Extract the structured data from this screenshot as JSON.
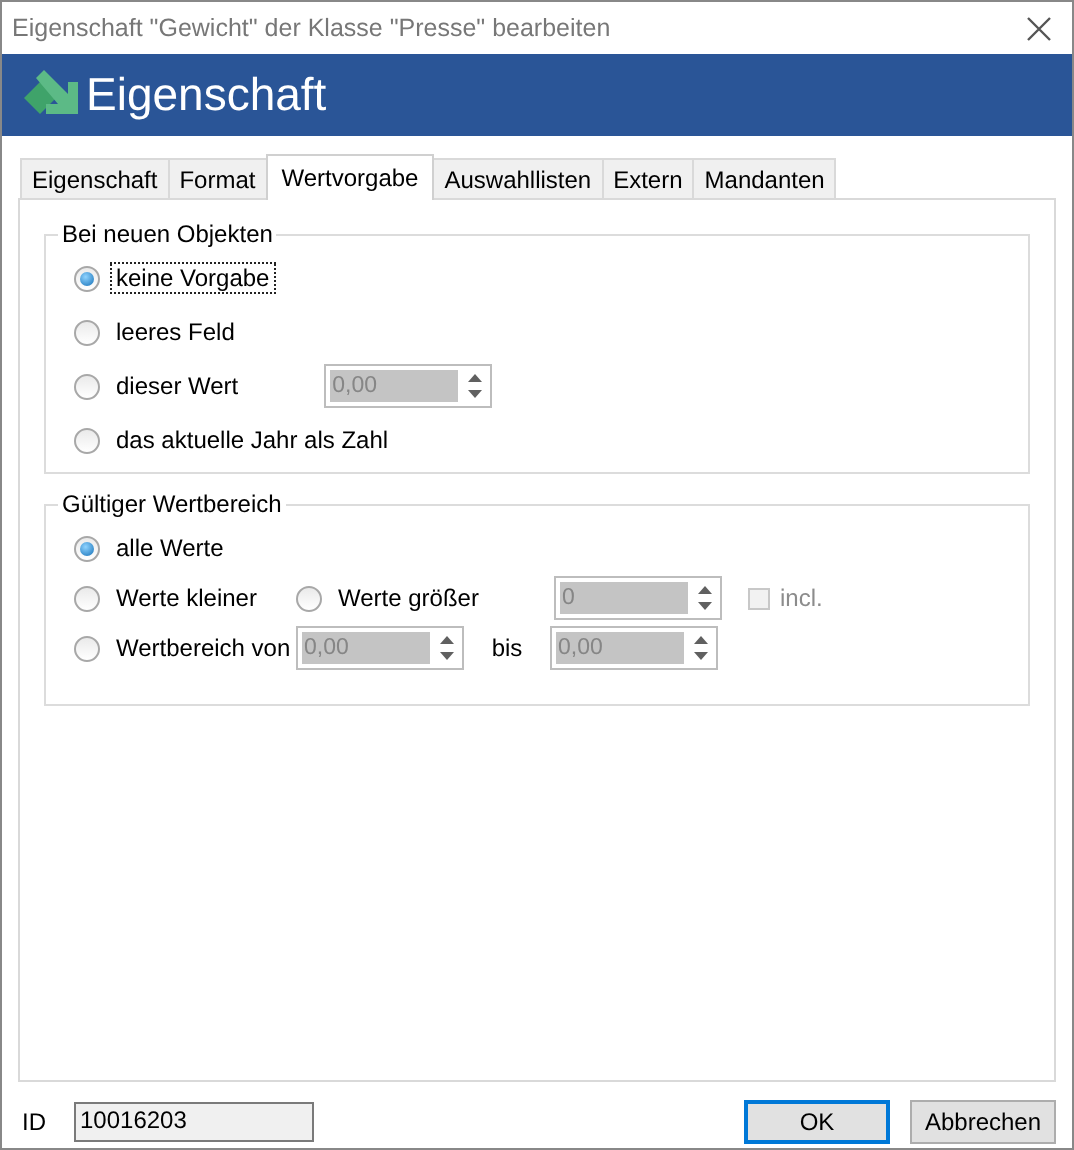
{
  "window": {
    "title": "Eigenschaft \"Gewicht\" der Klasse \"Presse\" bearbeiten"
  },
  "header": {
    "title": "Eigenschaft"
  },
  "tabs": [
    {
      "label": "Eigenschaft",
      "selected": false
    },
    {
      "label": "Format",
      "selected": false
    },
    {
      "label": "Wertvorgabe",
      "selected": true
    },
    {
      "label": "Auswahllisten",
      "selected": false
    },
    {
      "label": "Extern",
      "selected": false
    },
    {
      "label": "Mandanten",
      "selected": false
    }
  ],
  "new_objects": {
    "title": "Bei neuen Objekten",
    "options": [
      {
        "kind": "radio",
        "label": "keine Vorgabe",
        "selected": true,
        "focused": true
      },
      {
        "kind": "radio",
        "label": "leeres Feld",
        "selected": false,
        "focused": false
      },
      {
        "kind": "radio_spin",
        "label": "dieser Wert",
        "selected": false,
        "focused": false,
        "spin": {
          "value": "0,00",
          "disabled": true
        }
      },
      {
        "kind": "radio",
        "label": "das aktuelle Jahr als Zahl",
        "selected": false,
        "focused": false
      }
    ]
  },
  "valid_range": {
    "title": "Gültiger Wertbereich",
    "all_values": {
      "label": "alle Werte",
      "selected": true
    },
    "less": {
      "label": "Werte kleiner",
      "selected": false
    },
    "greater": {
      "label": "Werte größer",
      "selected": false
    },
    "bound_spin": {
      "value": "0",
      "disabled": true
    },
    "incl": {
      "label": "incl.",
      "checked": false,
      "disabled": true
    },
    "range": {
      "label": "Wertbereich von",
      "selected": false
    },
    "range_from": {
      "value": "0,00",
      "disabled": true
    },
    "bis_label": "bis",
    "range_to": {
      "value": "0,00",
      "disabled": true
    }
  },
  "footer": {
    "id_label": "ID",
    "id_value": "10016203",
    "buttons": [
      {
        "label": "OK",
        "default": true
      },
      {
        "label": "Abbrechen",
        "default": false
      }
    ]
  }
}
